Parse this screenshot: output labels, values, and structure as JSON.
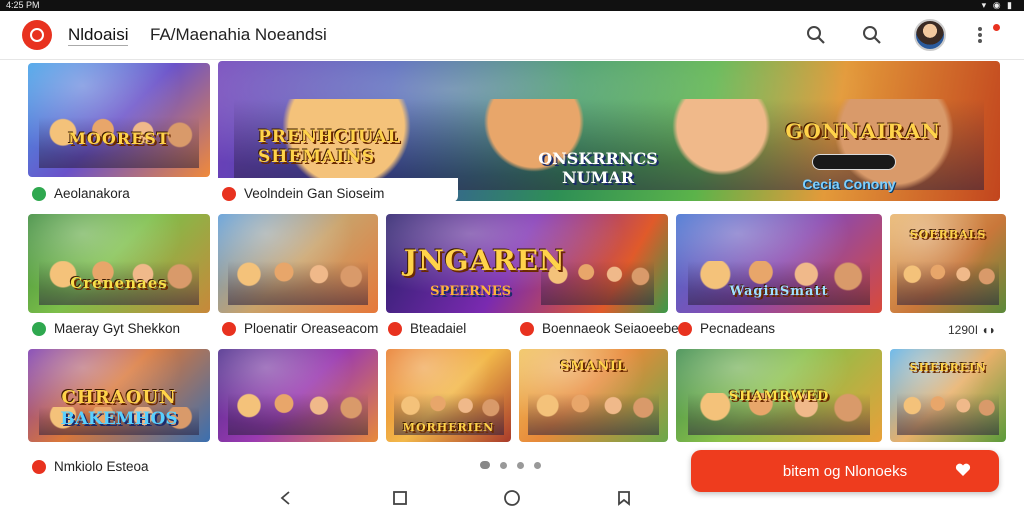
{
  "status": {
    "time": "4:25 PM",
    "system": "▾ ◉ ▮"
  },
  "header": {
    "app_name": "Nldoaisi",
    "subtitle": "FA/Maenahia Noeandsi",
    "icons": [
      "search-icon",
      "search-icon",
      "avatar",
      "more-vertical-icon"
    ]
  },
  "hero": {
    "left_tile_label": "Aeolanakora",
    "banner_label": "Veolndein Gan Sioseim",
    "title_left": "PRENHCIUAL SHEMAINS",
    "title_mid": "ONSKRRNCS NUMAR",
    "title_right": "GONNAIRAN",
    "tag": "Cecia Conony",
    "left_tile_title": "MOOREST"
  },
  "row2": {
    "tiles": [
      {
        "title": "Crenenaes"
      },
      {
        "title": ""
      },
      {
        "title": "JNGAREN",
        "sub": "SPEERNES"
      },
      {
        "title": "WaginSmatt"
      },
      {
        "title": "SOERBALS"
      }
    ],
    "labels": [
      {
        "text": "Maeray Gyt Shekkon",
        "badge": "green"
      },
      {
        "text": "Ploenatir Oreaseacom",
        "badge": "red"
      },
      {
        "text": "Bteadaiel",
        "badge": "red"
      },
      {
        "text": "Boennaeok Seiaoeebe",
        "badge": "red"
      },
      {
        "text": "Pecnadeans",
        "badge": "red"
      }
    ],
    "count": "1290I ◖◗"
  },
  "row3": {
    "tiles": [
      {
        "title": "CHRAOUN",
        "sub": "BAKEMHOS"
      },
      {
        "title": ""
      },
      {
        "title": "MORHERIEN"
      },
      {
        "title": "SMANIL"
      },
      {
        "title": "SHAMRWED"
      },
      {
        "title": "SHEBREIN"
      }
    ],
    "labels": [
      {
        "text": "Nmkiolo Esteoa",
        "badge": "red"
      }
    ]
  },
  "fab": {
    "label": "bitem og Nlonoeks"
  },
  "colors": {
    "accent": "#ee3c1e",
    "badge_green": "#2fa84f"
  }
}
